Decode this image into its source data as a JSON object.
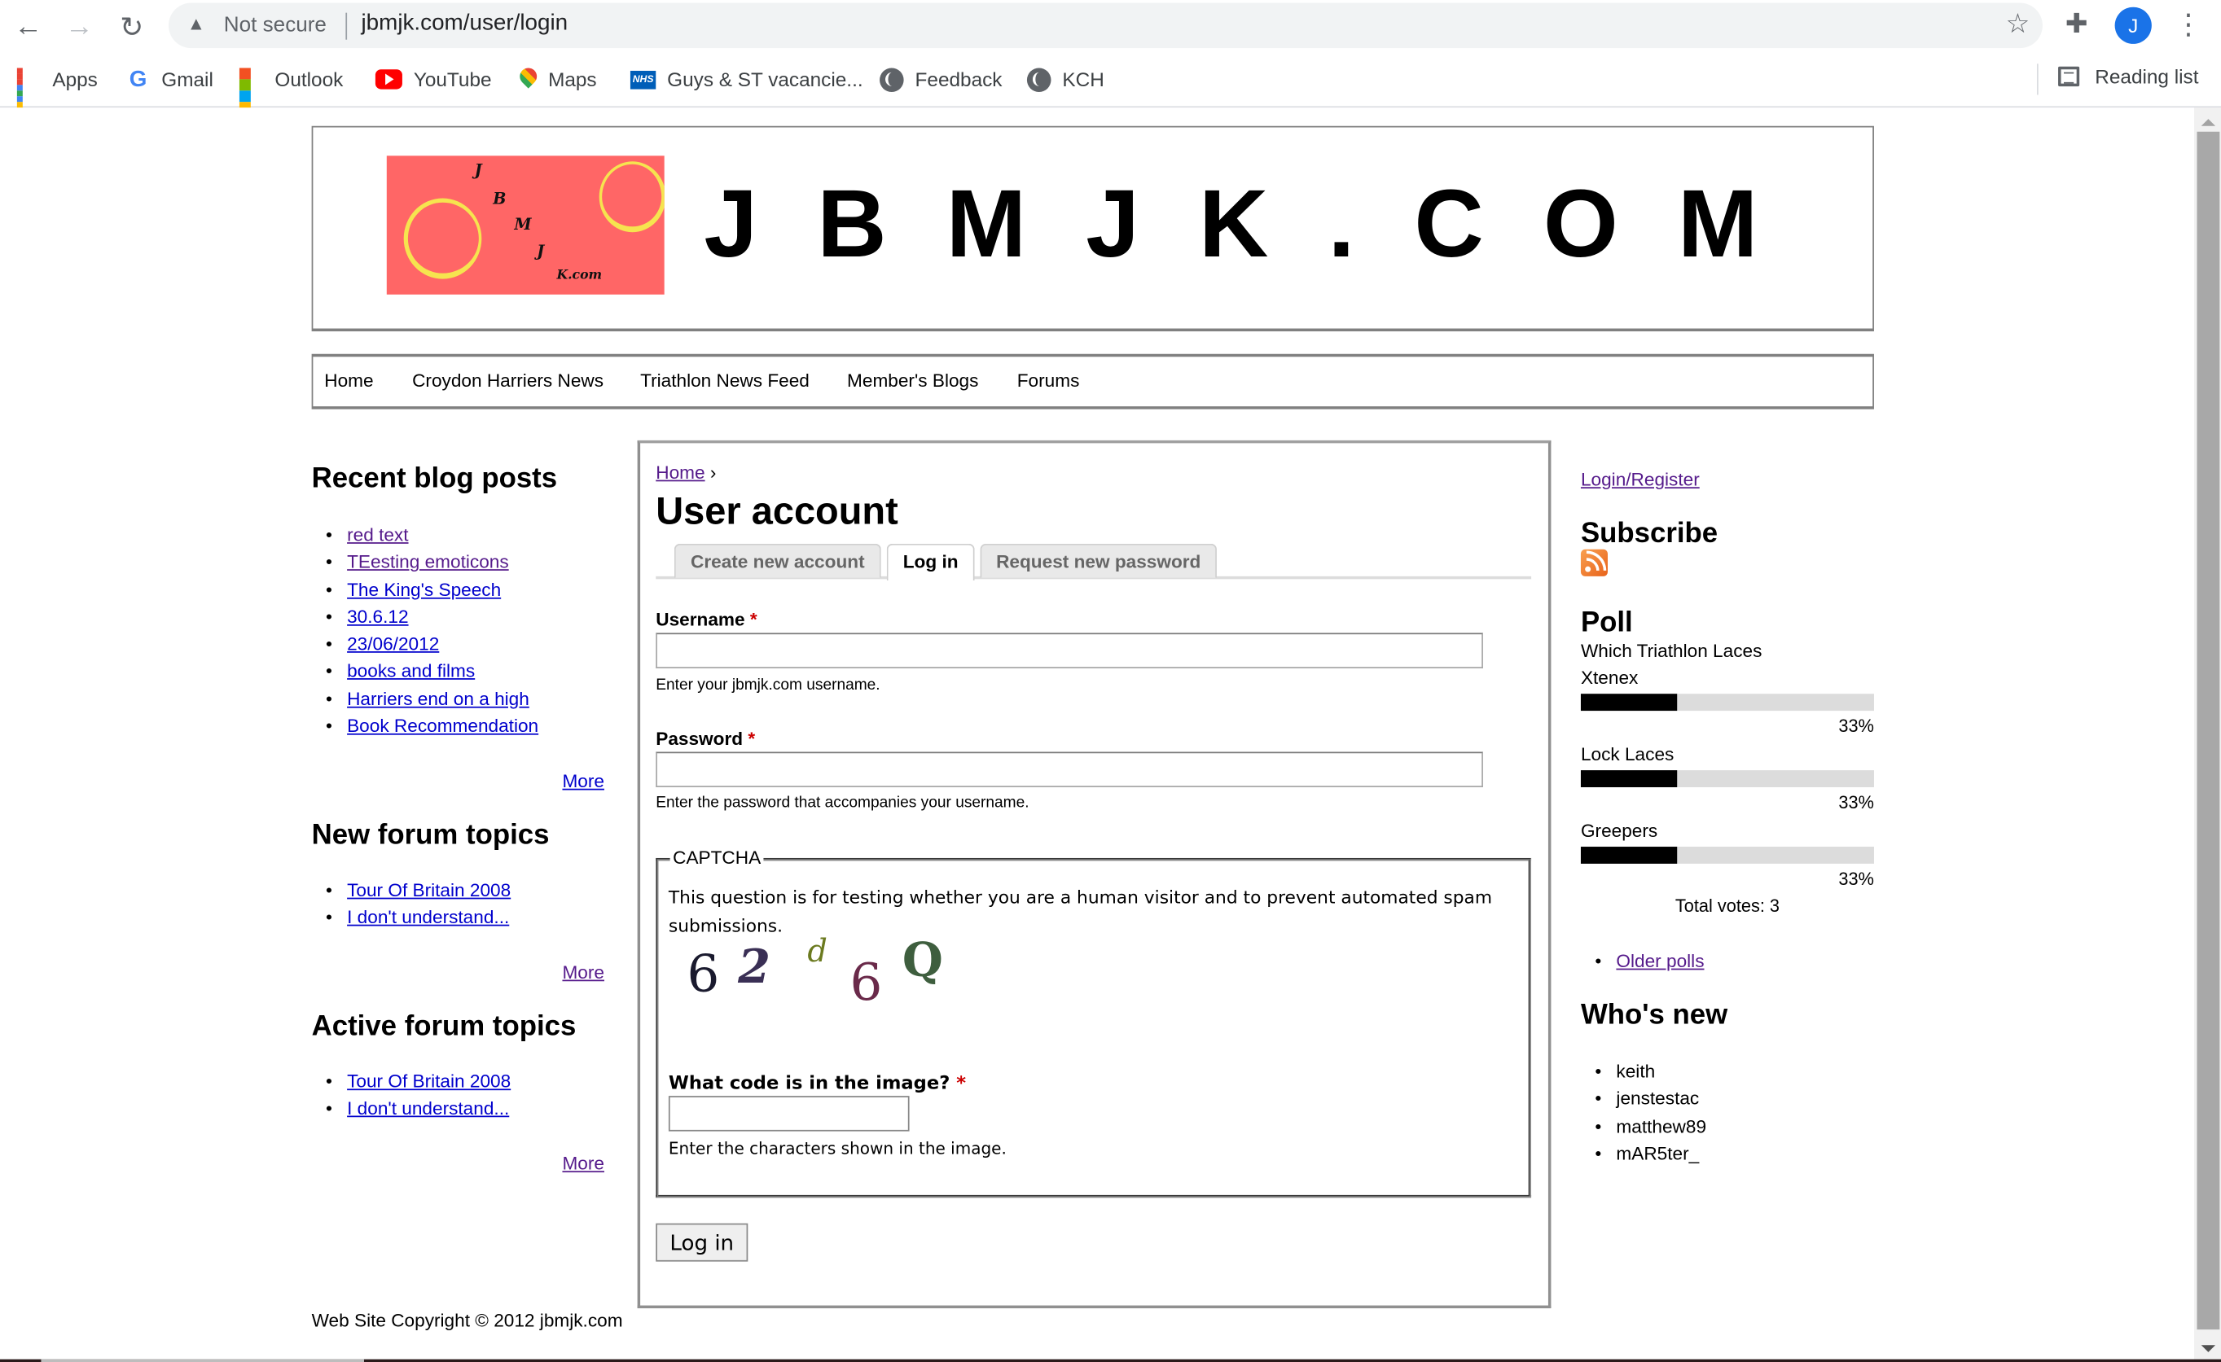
{
  "browser": {
    "security_label": "Not secure",
    "url": "jbmjk.com/user/login",
    "profile_initial": "J",
    "bookmarks": [
      {
        "label": "Apps",
        "icon": "apps-grid-icon"
      },
      {
        "label": "Gmail",
        "icon": "google-icon"
      },
      {
        "label": "Outlook",
        "icon": "microsoft-icon"
      },
      {
        "label": "YouTube",
        "icon": "youtube-icon"
      },
      {
        "label": "Maps",
        "icon": "maps-pin-icon"
      },
      {
        "label": "Guys & ST vacancie...",
        "icon": "nhs-icon"
      },
      {
        "label": "Feedback",
        "icon": "globe-icon"
      },
      {
        "label": "KCH",
        "icon": "globe-icon"
      }
    ],
    "reading_list_label": "Reading list"
  },
  "site": {
    "title": "JBMJK.COM",
    "logo_letters": [
      "J",
      "B",
      "M",
      "J",
      "K.com"
    ],
    "nav": [
      "Home",
      "Croydon Harriers News",
      "Triathlon News Feed",
      "Member's Blogs",
      "Forums"
    ]
  },
  "left_sidebar": {
    "recent_blog_posts": {
      "title": "Recent blog posts",
      "items": [
        {
          "label": "red text",
          "visited": true
        },
        {
          "label": "TEesting emoticons",
          "visited": true
        },
        {
          "label": "The King's Speech",
          "visited": false
        },
        {
          "label": "30.6.12",
          "visited": false
        },
        {
          "label": "23/06/2012",
          "visited": false
        },
        {
          "label": "books and films",
          "visited": false
        },
        {
          "label": "Harriers end on a high",
          "visited": false
        },
        {
          "label": "Book Recommendation",
          "visited": false
        }
      ],
      "more": "More"
    },
    "new_forum_topics": {
      "title": "New forum topics",
      "items": [
        "Tour Of Britain 2008",
        "I don't understand..."
      ],
      "more": "More"
    },
    "active_forum_topics": {
      "title": "Active forum topics",
      "items": [
        "Tour Of Britain 2008",
        "I don't understand..."
      ],
      "more": "More"
    }
  },
  "main": {
    "breadcrumb": {
      "home": "Home",
      "separator": "›"
    },
    "title": "User account",
    "tabs": [
      {
        "label": "Create new account",
        "active": false
      },
      {
        "label": "Log in",
        "active": true
      },
      {
        "label": "Request new password",
        "active": false
      }
    ],
    "username": {
      "label": "Username",
      "required_mark": "*",
      "value": "",
      "description": "Enter your jbmjk.com username."
    },
    "password": {
      "label": "Password",
      "required_mark": "*",
      "value": "",
      "description": "Enter the password that accompanies your username."
    },
    "captcha": {
      "legend": "CAPTCHA",
      "info": "This question is for testing whether you are a human visitor and to prevent automated spam submissions.",
      "image_chars": [
        "6",
        "2",
        "d",
        "6",
        "Q"
      ],
      "question": "What code is in the image?",
      "required_mark": "*",
      "value": "",
      "description": "Enter the characters shown in the image."
    },
    "submit_label": "Log in"
  },
  "right_sidebar": {
    "login_register": "Login/Register",
    "subscribe_title": "Subscribe",
    "poll": {
      "title": "Poll",
      "question": "Which Triathlon Laces",
      "choices": [
        {
          "label": "Xtenex",
          "percent": 33
        },
        {
          "label": "Lock Laces",
          "percent": 33
        },
        {
          "label": "Greepers",
          "percent": 33
        }
      ],
      "percent_suffix": "%",
      "total_votes": "Total votes: 3",
      "older_polls": "Older polls"
    },
    "whos_new": {
      "title": "Who's new",
      "users": [
        "keith",
        "jenstestac",
        "matthew89",
        "mAR5ter_"
      ]
    }
  },
  "footer": {
    "copyright": "Web Site Copyright © 2012 jbmjk.com"
  }
}
